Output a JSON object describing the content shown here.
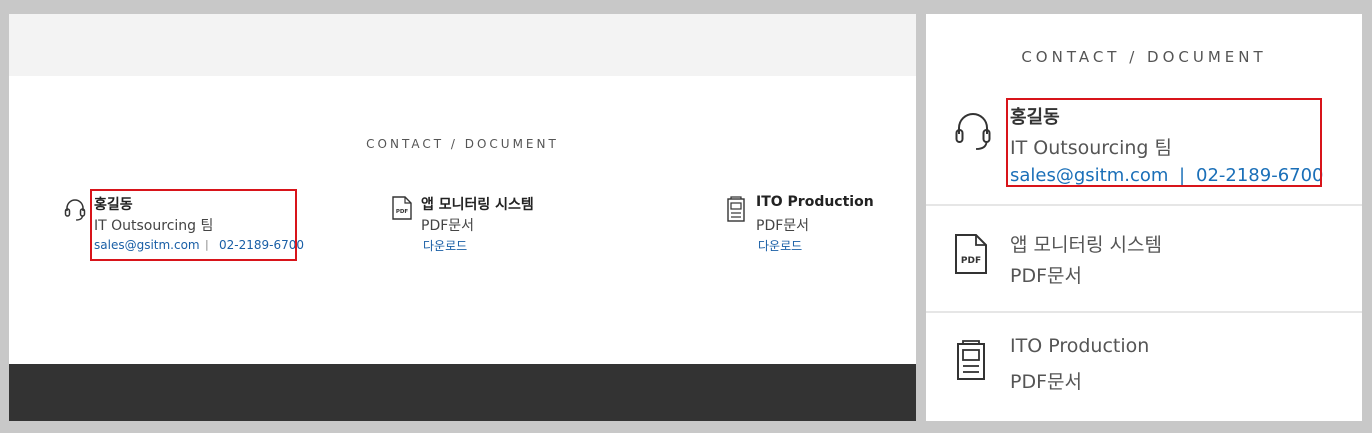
{
  "left_panel": {
    "section_title": "CONTACT / DOCUMENT",
    "contact": {
      "name": "홍길동",
      "team": "IT Outsourcing 팀",
      "email": "sales@gsitm.com",
      "separator": "|",
      "phone": "02-2189-6700",
      "icon": "headset-icon"
    },
    "documents": [
      {
        "title": "앱 모니터링 시스템",
        "type": "PDF문서",
        "action": "다운로드",
        "icon": "pdf-icon",
        "icon_label": "PDF"
      },
      {
        "title": "ITO Production",
        "type": "PDF문서",
        "action": "다운로드",
        "icon": "document-icon"
      }
    ]
  },
  "right_panel": {
    "section_title": "CONTACT / DOCUMENT",
    "contact": {
      "name": "홍길동",
      "team": "IT Outsourcing 팀",
      "email": "sales@gsitm.com",
      "separator": "|",
      "phone": "02-2189-6700",
      "icon": "headset-icon"
    },
    "documents": [
      {
        "title": "앱 모니터링 시스템",
        "type": "PDF문서",
        "icon": "pdf-icon",
        "icon_label": "PDF"
      },
      {
        "title": "ITO Production",
        "type": "PDF문서",
        "icon": "document-icon"
      }
    ]
  },
  "colors": {
    "highlight": "#d8141a",
    "link": "#1a5fa6",
    "footer": "#333333",
    "top_band": "#f3f3f3"
  }
}
